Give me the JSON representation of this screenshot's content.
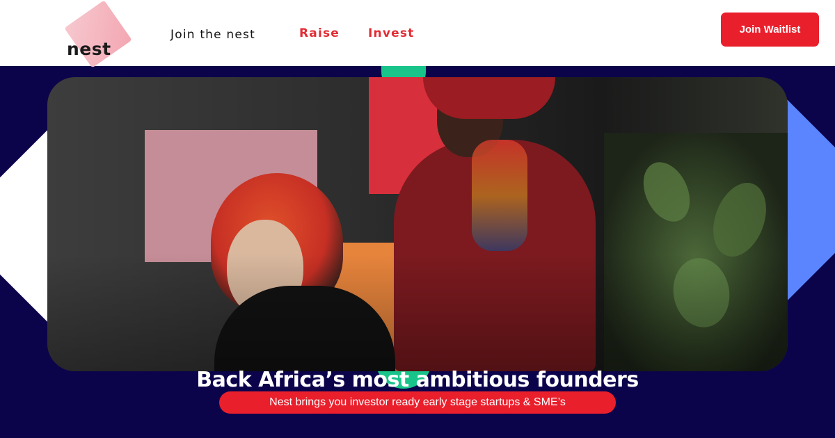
{
  "brand": {
    "logo_text": "nest"
  },
  "nav": {
    "links": [
      {
        "label": "Join the nest"
      },
      {
        "label": "Raise"
      },
      {
        "label": "Invest"
      }
    ],
    "cta_label": "Join Waitlist"
  },
  "hero": {
    "headline": "Back Africa’s most ambitious founders",
    "tagline": "Nest brings you investor ready early stage startups & SME’s"
  },
  "colors": {
    "accent_red": "#ea1f2c",
    "hero_background": "#0c044b",
    "accent_blue": "#5b85ff",
    "accent_teal": "#19c48b",
    "logo_pink": "#f3a7b2"
  }
}
